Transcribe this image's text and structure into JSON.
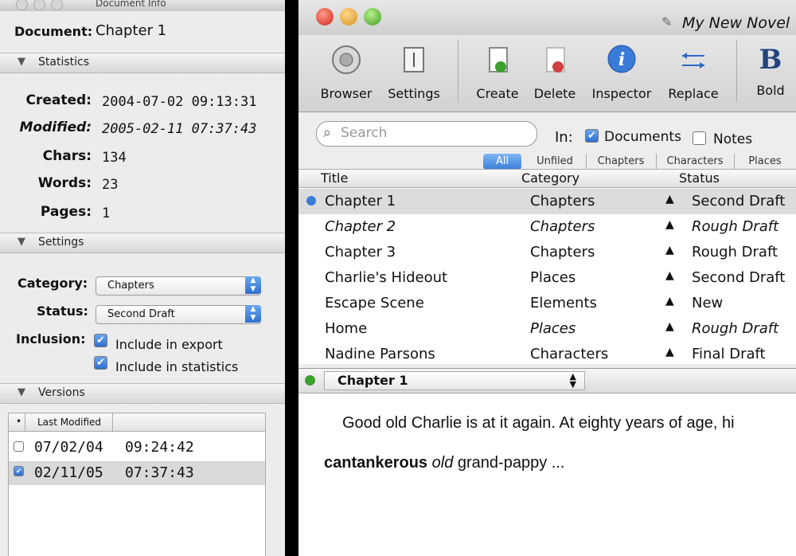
{
  "inspector": {
    "title": "Document Info",
    "document_label": "Document:",
    "document_name": "Chapter 1",
    "sections": {
      "statistics": "Statistics",
      "settings": "Settings",
      "versions": "Versions"
    },
    "stats": [
      {
        "label": "Created:",
        "value": "2004-07-02 09:13:31"
      },
      {
        "label": "Modified:",
        "value": "2005-02-11 07:37:43"
      },
      {
        "label": "Chars:",
        "value": "134"
      },
      {
        "label": "Words:",
        "value": "23"
      },
      {
        "label": "Pages:",
        "value": "1"
      }
    ],
    "settings": {
      "category_label": "Category:",
      "category_value": "Chapters",
      "status_label": "Status:",
      "status_value": "Second Draft",
      "inclusion_label": "Inclusion:",
      "include_export": "Include in export",
      "include_statistics": "Include in statistics"
    },
    "versions": {
      "header_dot": "•",
      "header_label": "Last Modified",
      "rows": [
        {
          "date": "07/02/04",
          "time": "09:24:42",
          "checked": false
        },
        {
          "date": "02/11/05",
          "time": "07:37:43",
          "checked": true
        }
      ]
    }
  },
  "main": {
    "title": "My New Novel",
    "toolbar": [
      "Browser",
      "Settings",
      "Create",
      "Delete",
      "Inspector",
      "Replace",
      "Bold"
    ],
    "search_placeholder": "Search",
    "in_label": "In:",
    "in_documents": "Documents",
    "in_notes": "Notes",
    "filters": [
      "All",
      "Unfiled",
      "Chapters",
      "Characters",
      "Places"
    ],
    "columns": [
      "Title",
      "Category",
      "Status"
    ],
    "rows": [
      {
        "title": "Chapter 1",
        "category": "Chapters",
        "status": "Second Draft",
        "italic": false
      },
      {
        "title": "Chapter 2",
        "category": "Chapters",
        "status": "Rough Draft",
        "italic": true
      },
      {
        "title": "Chapter 3",
        "category": "Chapters",
        "status": "Rough Draft",
        "italic": false
      },
      {
        "title": "Charlie's Hideout",
        "category": "Places",
        "status": "Second Draft",
        "italic": false
      },
      {
        "title": "Escape Scene",
        "category": "Elements",
        "status": "New",
        "italic": false
      },
      {
        "title": "Home",
        "category": "Places",
        "status": "Rough Draft",
        "italic": true
      },
      {
        "title": "Nadine Parsons",
        "category": "Characters",
        "status": "Final Draft",
        "italic": false
      }
    ],
    "editor_doc": "Chapter 1",
    "editor_text": {
      "line1": "Good old Charlie is at it again. At eighty years of age, hi",
      "bold": "cantankerous",
      "italic": "old",
      "rest": " grand-pappy ..."
    }
  }
}
